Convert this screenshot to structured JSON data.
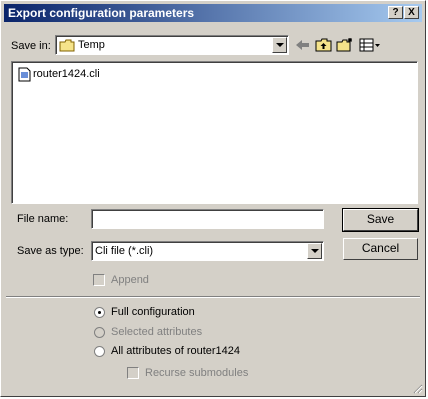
{
  "window": {
    "title": "Export configuration parameters",
    "help_btn": "?",
    "close_btn": "X"
  },
  "save_in": {
    "label": "Save in:",
    "value": "Temp"
  },
  "files": [
    {
      "name": "router1424.cli"
    }
  ],
  "file_name": {
    "label": "File name:",
    "value": ""
  },
  "save_type": {
    "label": "Save as type:",
    "value": "Cli file (*.cli)"
  },
  "buttons": {
    "save": "Save",
    "cancel": "Cancel"
  },
  "append": {
    "label": "Append",
    "checked": false
  },
  "options": [
    {
      "label": "Full configuration",
      "selected": true
    },
    {
      "label": "Selected attributes",
      "selected": false
    },
    {
      "label": "All attributes of router1424",
      "selected": false
    }
  ],
  "recurse": {
    "label": "Recurse submodules",
    "checked": false
  }
}
